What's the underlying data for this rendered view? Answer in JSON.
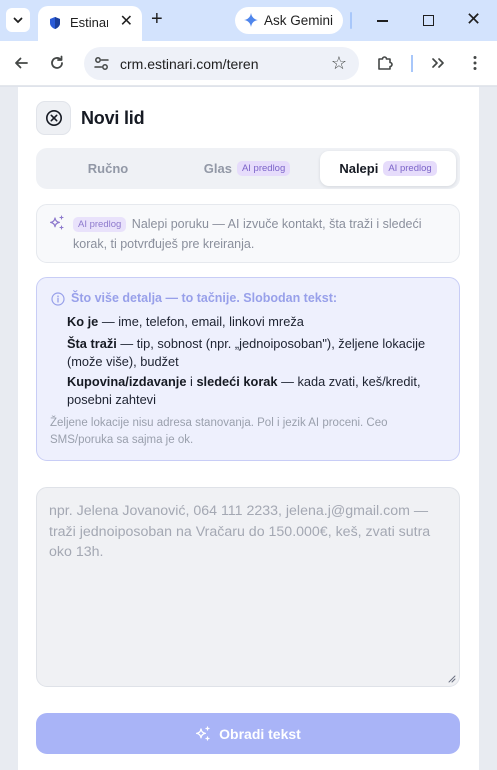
{
  "browser": {
    "tab_title": "Estinari",
    "gemini_label": "Ask Gemini",
    "url": "crm.estinari.com/teren"
  },
  "page": {
    "title": "Novi lid",
    "tabs": [
      {
        "label": "Ručno",
        "badge": "",
        "active": false
      },
      {
        "label": "Glas",
        "badge": "AI predlog",
        "active": false
      },
      {
        "label": "Nalepi",
        "badge": "AI predlog",
        "active": true
      }
    ],
    "hint": {
      "badge": "AI predlog",
      "text": "Nalepi poruku — AI izvuče kontakt, šta traži i sledeći korak, ti potvrđuješ pre kreiranja."
    },
    "info": {
      "title": "Što više detalja — to tačnije. Slobodan tekst:",
      "line1_bold": "Ko je",
      "line1_rest": " — ime, telefon, email, linkovi mreža",
      "line2_bold": "Šta traži",
      "line2_rest": " — tip, sobnost (npr. „jednoiposoban\"), željene lokacije (može više), budžet",
      "line3_bold1": "Kupovina/izdavanje",
      "line3_mid": " i ",
      "line3_bold2": "sledeći korak",
      "line3_rest": " — kada zvati, keš/kredit, posebni zahtevi",
      "footnote": "Željene lokacije nisu adresa stanovanja. Pol i jezik AI proceni. Ceo SMS/poruka sa sajma je ok."
    },
    "textarea_placeholder": "npr. Jelena Jovanović, 064 111 2233, jelena.j@gmail.com — traži jednoiposoban na Vračaru do 150.000€, keš, zvati sutra oko 13h.",
    "submit_label": "Obradi tekst"
  }
}
